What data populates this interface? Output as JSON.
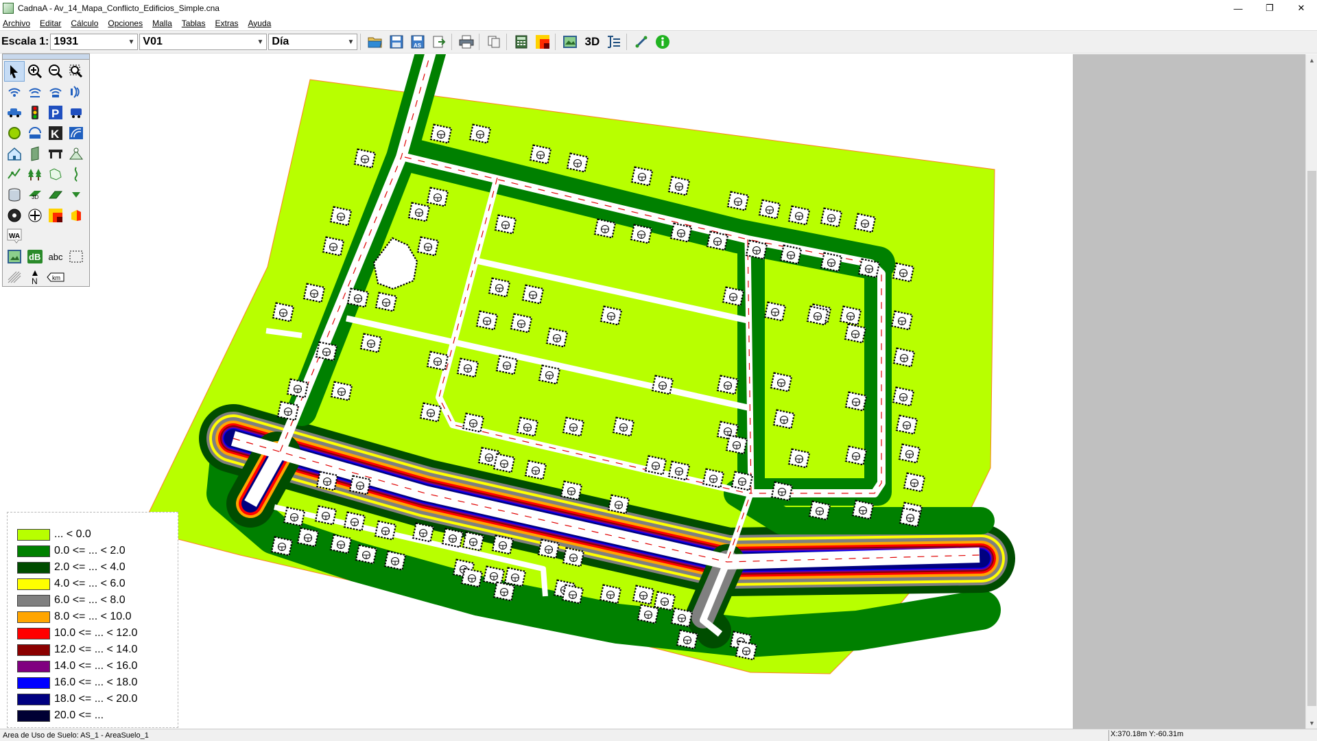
{
  "window": {
    "title": "CadnaA - Av_14_Mapa_Conflicto_Edificios_Simple.cna",
    "minimize_glyph": "—",
    "maximize_glyph": "❐",
    "close_glyph": "✕"
  },
  "menu": {
    "items": [
      "Archivo",
      "Editar",
      "Cálculo",
      "Opciones",
      "Malla",
      "Tablas",
      "Extras",
      "Ayuda"
    ]
  },
  "toolbar": {
    "scale_label": "Escala 1:",
    "scale_value": "1931",
    "variant_value": "V01",
    "period_value": "Día",
    "three_d_label": "3D",
    "icons": [
      "open-icon",
      "save-icon",
      "save-as-icon",
      "export-icon",
      "print-icon",
      "copy-icon",
      "calculator-icon",
      "grid-color-icon",
      "object-tree-icon",
      "3d-label",
      "table-icon",
      "measure-icon",
      "info-icon"
    ]
  },
  "palette": {
    "tools": [
      "select-arrow-icon",
      "zoom-in-icon",
      "zoom-out-icon",
      "zoom-window-icon",
      "point-source-icon",
      "line-source-icon",
      "area-source-icon",
      "vertical-source-icon",
      "road-icon",
      "traffic-light-icon",
      "parking-icon",
      "railway-icon",
      "industry-icon",
      "tunnel-icon",
      "kilometer-icon",
      "barrier-icon",
      "building-icon",
      "wall-icon",
      "bridge-icon",
      "cylinder-object-icon",
      "contour-icon",
      "trees-icon",
      "area-icon",
      "terrain-line-icon",
      "cylinder-icon",
      "3d-reflector-icon",
      "ground-absorption-icon",
      "dropdown-marker-icon",
      "receiver-icon",
      "crossing-icon",
      "noise-map-icon",
      "facade-icon",
      "wa-icon",
      "image-icon",
      "db-icon",
      "text-abc-icon",
      "selection-box-icon",
      "hatching-icon",
      "north-arrow-icon",
      "km-label-icon"
    ],
    "wa_label": "WA",
    "db_label": "dB",
    "abc_label": "abc",
    "km_label": "km",
    "north_label": "N"
  },
  "legend": {
    "entries": [
      {
        "label": "... < 0.0",
        "color": "#b8ff00"
      },
      {
        "label": "0.0 <= ... < 2.0",
        "color": "#008000"
      },
      {
        "label": "2.0 <= ... < 4.0",
        "color": "#004d00"
      },
      {
        "label": "4.0 <= ... < 6.0",
        "color": "#ffff00"
      },
      {
        "label": "6.0 <= ... < 8.0",
        "color": "#808080"
      },
      {
        "label": "8.0 <= ... < 10.0",
        "color": "#ffa500"
      },
      {
        "label": "10.0 <= ... < 12.0",
        "color": "#ff0000"
      },
      {
        "label": "12.0 <= ... < 14.0",
        "color": "#8b0000"
      },
      {
        "label": "14.0 <= ... < 16.0",
        "color": "#800080"
      },
      {
        "label": "16.0 <= ... < 18.0",
        "color": "#0000ff"
      },
      {
        "label": "18.0 <= ... < 20.0",
        "color": "#000080"
      },
      {
        "label": "20.0 <= ...",
        "color": "#000033"
      }
    ]
  },
  "map": {
    "background_color": "#b8ff00",
    "boundary_color": "#ff7f27",
    "road_color": "#ffffff",
    "building_color": "#ffffff"
  },
  "status": {
    "left_text": "Area de Uso de Suelo: AS_1 - AreaSuelo_1",
    "coords_text": "X:370.18m Y:-60.31m"
  }
}
